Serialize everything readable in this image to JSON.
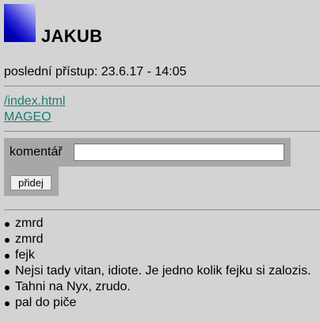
{
  "profile": {
    "avatar_icon": "gradient-avatar-icon",
    "name": "JAKUB",
    "last_access": "poslední přístup: 23.6.17 - 14:05"
  },
  "links": [
    {
      "label": "/index.html"
    },
    {
      "label": "MAGEO"
    }
  ],
  "comment_form": {
    "label": "komentář",
    "input_value": "",
    "submit_label": "přidej"
  },
  "comments": [
    "zmrd",
    "zmrd",
    "fejk",
    "Nejsi tady vitan, idiote. Je jedno kolik fejku si zalozis.",
    "Tahni na Nyx, zrudo.",
    "pal do piče"
  ],
  "colors": {
    "background": "#d3d3d3",
    "link": "#1f7a6e",
    "form_panel": "#a7a7a7"
  }
}
